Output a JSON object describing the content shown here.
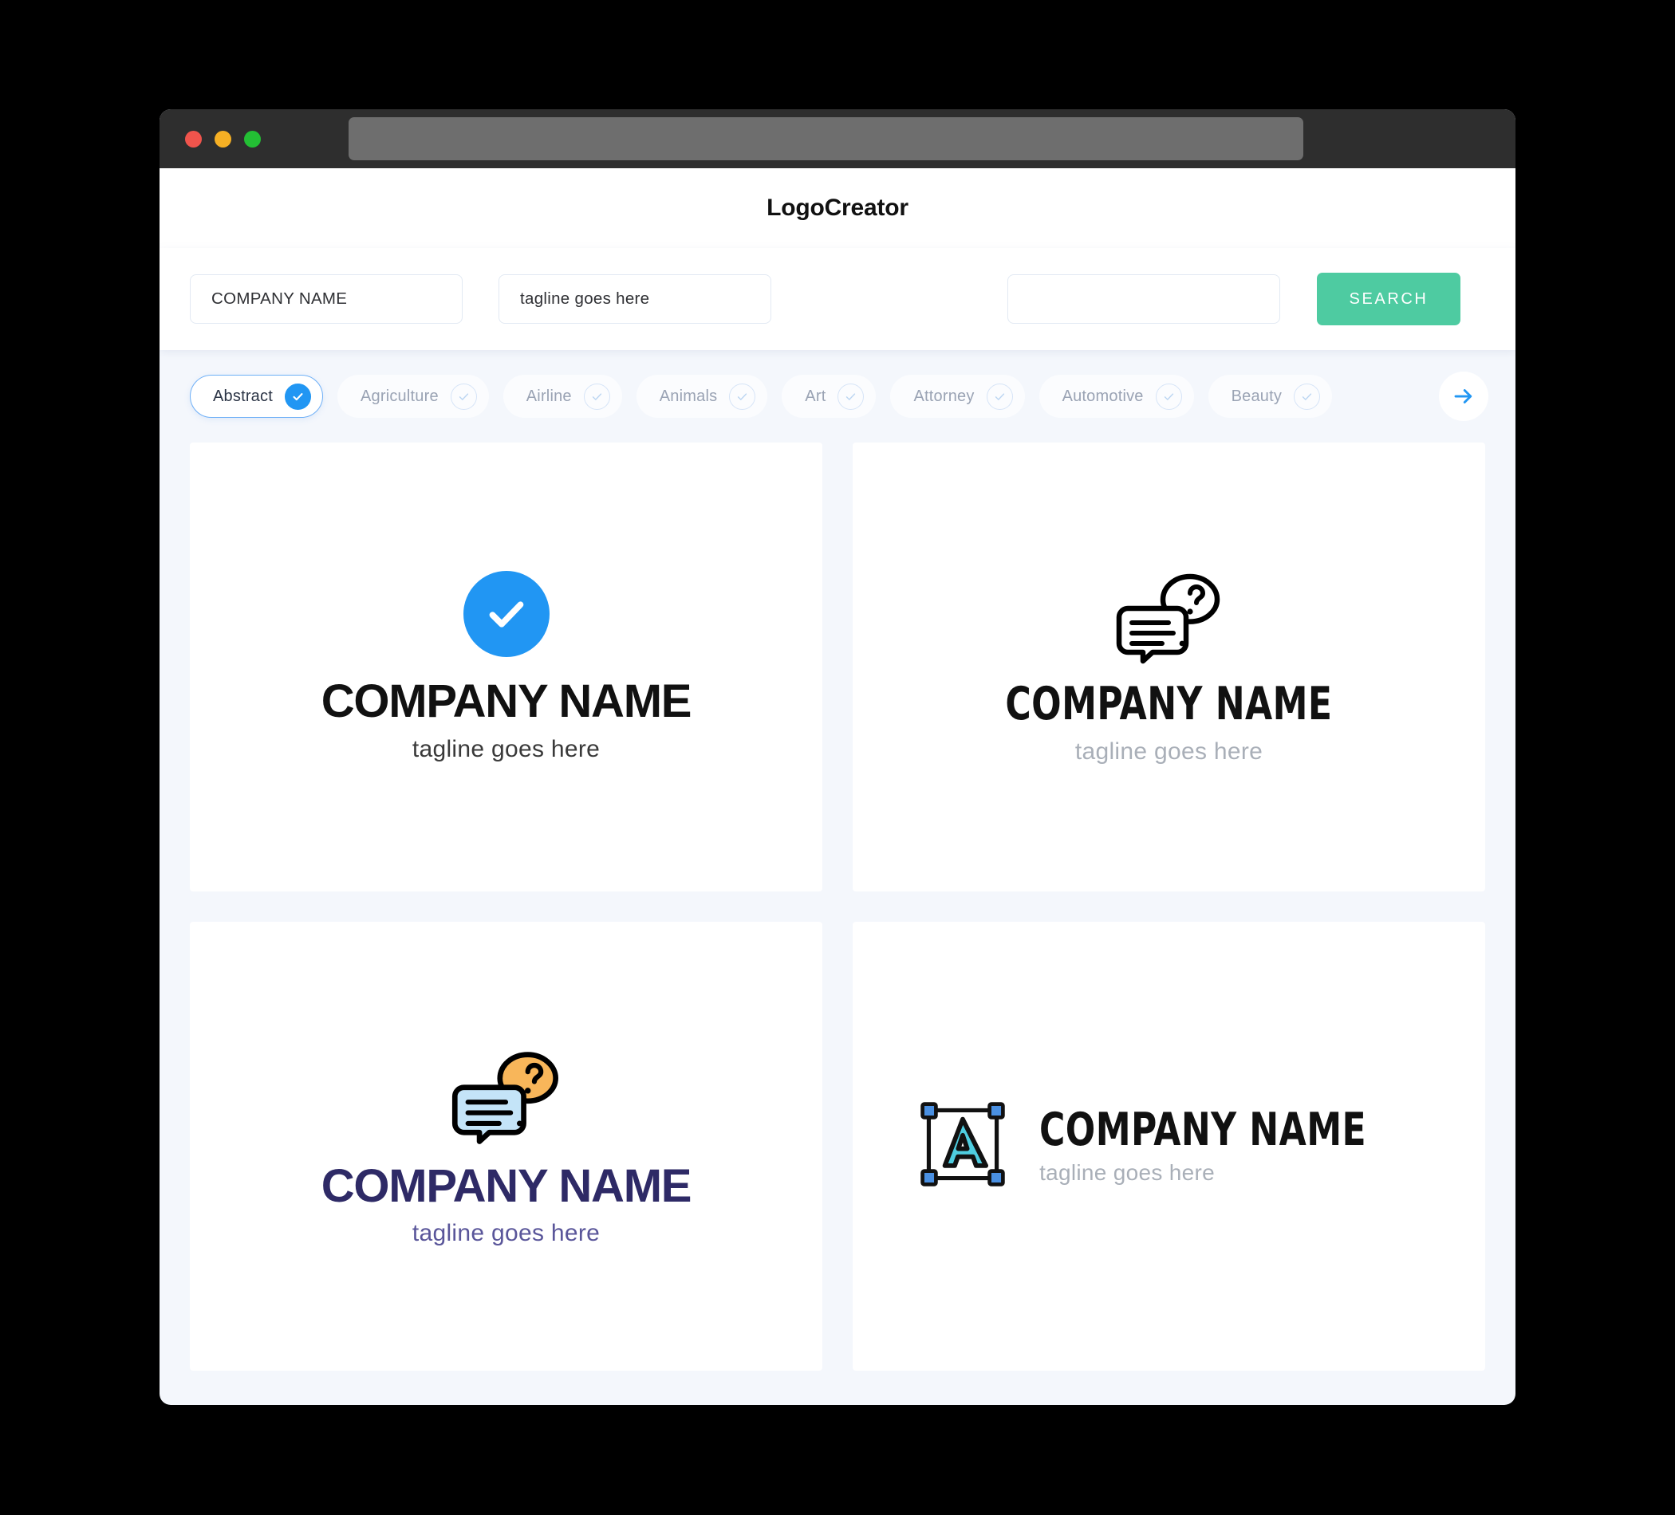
{
  "window": {
    "traffic_lights": [
      "close",
      "minimize",
      "maximize"
    ],
    "url_value": ""
  },
  "header": {
    "app_title": "LogoCreator"
  },
  "search": {
    "company_value": "COMPANY NAME",
    "tagline_value": "tagline goes here",
    "extra_value": "",
    "search_label": "SEARCH"
  },
  "categories": {
    "items": [
      {
        "label": "Abstract",
        "selected": true
      },
      {
        "label": "Agriculture",
        "selected": false
      },
      {
        "label": "Airline",
        "selected": false
      },
      {
        "label": "Animals",
        "selected": false
      },
      {
        "label": "Art",
        "selected": false
      },
      {
        "label": "Attorney",
        "selected": false
      },
      {
        "label": "Automotive",
        "selected": false
      },
      {
        "label": "Beauty",
        "selected": false
      }
    ],
    "next_label": "→"
  },
  "logos": [
    {
      "icon": "check-circle-icon",
      "name": "COMPANY NAME",
      "tagline": "tagline goes here",
      "name_color": "#111111",
      "tagline_color": "#3a3a3a",
      "accent_color": "#2196f3",
      "layout": "stacked"
    },
    {
      "icon": "speech-bubbles-question-outline-icon",
      "name": "COMPANY NAME",
      "tagline": "tagline goes here",
      "name_color": "#111111",
      "tagline_color": "#a9afb8",
      "accent_color": "#000000",
      "layout": "stacked"
    },
    {
      "icon": "speech-bubbles-question-color-icon",
      "name": "COMPANY NAME",
      "tagline": "tagline goes here",
      "name_color": "#2e2a66",
      "tagline_color": "#5a569a",
      "accent_color": "#f7b14e",
      "layout": "stacked"
    },
    {
      "icon": "letter-a-selection-icon",
      "name": "COMPANY NAME",
      "tagline": "tagline goes here",
      "name_color": "#111111",
      "tagline_color": "#a9afb8",
      "accent_color": "#4ecde0",
      "layout": "horizontal"
    }
  ]
}
